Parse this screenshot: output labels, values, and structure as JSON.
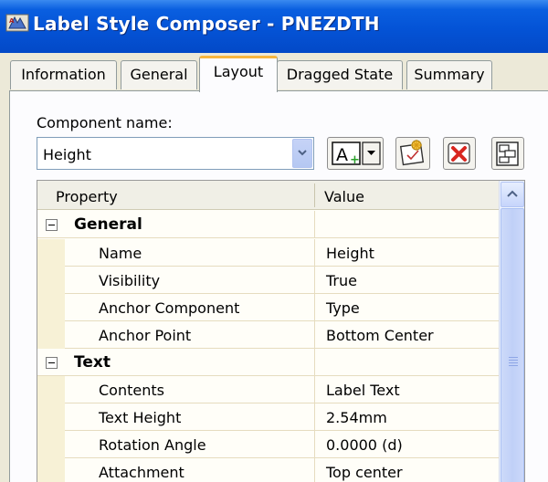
{
  "window": {
    "title": "Label Style Composer - PNEZDTH"
  },
  "tabs": [
    {
      "label": "Information",
      "active": false
    },
    {
      "label": "General",
      "active": false
    },
    {
      "label": "Layout",
      "active": true
    },
    {
      "label": "Dragged State",
      "active": false
    },
    {
      "label": "Summary",
      "active": false
    }
  ],
  "component": {
    "label": "Component name:",
    "value": "Height"
  },
  "toolbar": {
    "buttons": [
      "add-component-icon",
      "copy-component-icon",
      "delete-component-icon",
      "draw-order-icon"
    ]
  },
  "grid": {
    "headers": {
      "property": "Property",
      "value": "Value"
    },
    "categories": [
      {
        "name": "General",
        "rows": [
          {
            "name": "Name",
            "value": "Height"
          },
          {
            "name": "Visibility",
            "value": "True"
          },
          {
            "name": "Anchor Component",
            "value": "Type"
          },
          {
            "name": "Anchor Point",
            "value": "Bottom Center"
          }
        ]
      },
      {
        "name": "Text",
        "rows": [
          {
            "name": "Contents",
            "value": "Label Text"
          },
          {
            "name": "Text Height",
            "value": "2.54mm"
          },
          {
            "name": "Rotation Angle",
            "value": "0.0000 (d)"
          },
          {
            "name": "Attachment",
            "value": "Top center"
          }
        ]
      }
    ]
  },
  "colors": {
    "titlebar": "#0453d6",
    "active_tab_accent": "#f6b63f",
    "delete_red": "#d8261f"
  }
}
